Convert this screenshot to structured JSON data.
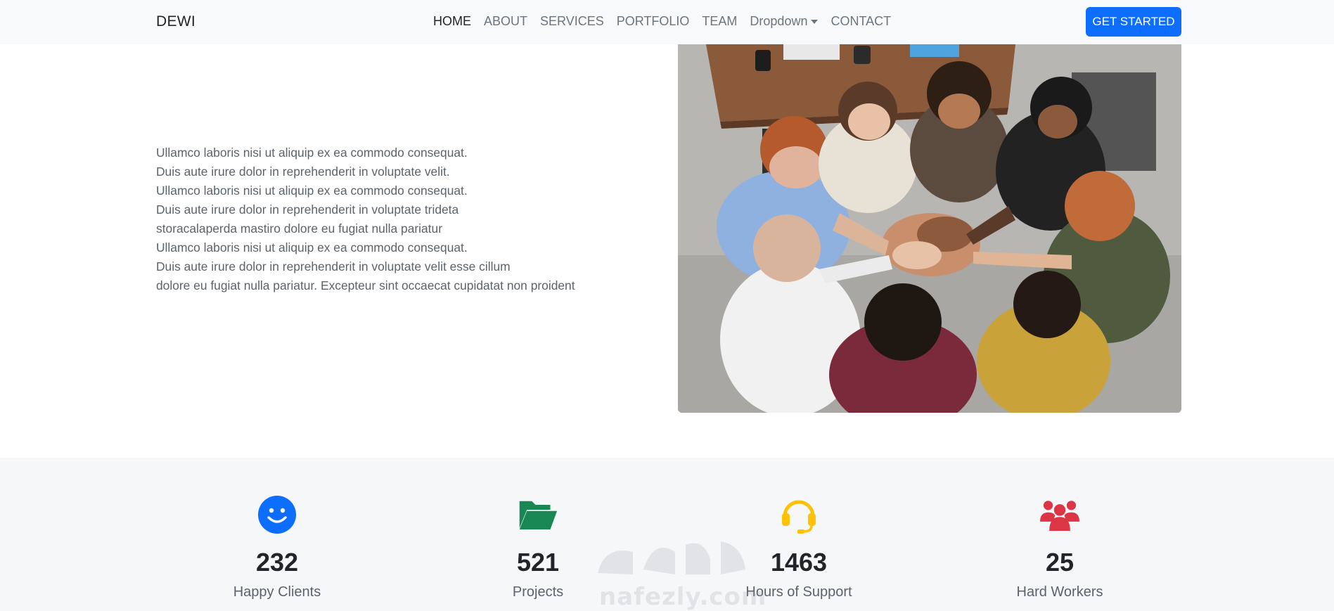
{
  "navbar": {
    "brand": "DEWI",
    "links": [
      {
        "label": "HOME",
        "active": true
      },
      {
        "label": "ABOUT"
      },
      {
        "label": "SERVICES"
      },
      {
        "label": "PORTFOLIO"
      },
      {
        "label": "TEAM"
      },
      {
        "label": "Dropdown",
        "has_caret": true
      },
      {
        "label": "CONTACT"
      }
    ],
    "cta_label": "GET STARTED"
  },
  "hero": {
    "lines": [
      "Ullamco laboris nisi ut aliquip ex ea commodo consequat.",
      "Duis aute irure dolor in reprehenderit in voluptate velit.",
      "Ullamco laboris nisi ut aliquip ex ea commodo consequat.",
      "Duis aute irure dolor in reprehenderit in voluptate trideta",
      "storacalaperda mastiro dolore eu fugiat nulla pariatur",
      "Ullamco laboris nisi ut aliquip ex ea commodo consequat.",
      "Duis aute irure dolor in reprehenderit in voluptate velit esse cillum",
      "dolore eu fugiat nulla pariatur. Excepteur sint occaecat cupidatat non proident"
    ]
  },
  "stats": [
    {
      "icon": "smile-icon",
      "color": "#0d6efd",
      "value": "232",
      "label": "Happy Clients"
    },
    {
      "icon": "folder-open-icon",
      "color": "#198754",
      "value": "521",
      "label": "Projects"
    },
    {
      "icon": "headset-icon",
      "color": "#ffc107",
      "value": "1463",
      "label": "Hours of Support"
    },
    {
      "icon": "people-icon",
      "color": "#dc3545",
      "value": "25",
      "label": "Hard Workers"
    }
  ],
  "watermark": {
    "latin": "nafezly.com"
  },
  "colors": {
    "primary": "#0d6efd",
    "navbar_bg": "#f8f9fa",
    "stats_bg": "#f6f7f9"
  }
}
